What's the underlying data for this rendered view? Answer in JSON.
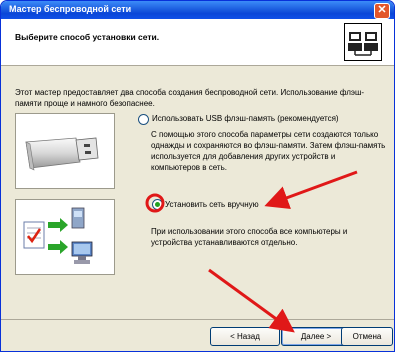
{
  "window": {
    "title": "Мастер беспроводной сети",
    "close_label": "✕"
  },
  "header": {
    "title": "Выберите способ установки сети."
  },
  "intro": "Этот мастер предоставляет два способа создания беспроводной сети. Использование флэш-памяти проще и намного безопаснее.",
  "options": [
    {
      "label": "Использовать USB флэш-память (рекомендуется)",
      "checked": false,
      "description": "С помощью этого способа параметры сети создаются только однажды и сохраняются во флэш-памяти. Затем флэш-память используется для добавления других устройств и компьютеров в сеть."
    },
    {
      "label": "Установить сеть вручную",
      "checked": true,
      "description": "При использовании этого способа все компьютеры и устройства устанавливаются отдельно."
    }
  ],
  "buttons": {
    "back": "< Назад",
    "next": "Далее >",
    "cancel": "Отмена"
  },
  "colors": {
    "title_bar": "#0a46d8",
    "annotation": "#e01818",
    "dialog_bg": "#ece9d8"
  },
  "icons": [
    "close-icon",
    "network-wizard-icon",
    "usb-flash-drive-icon",
    "network-devices-icon"
  ]
}
